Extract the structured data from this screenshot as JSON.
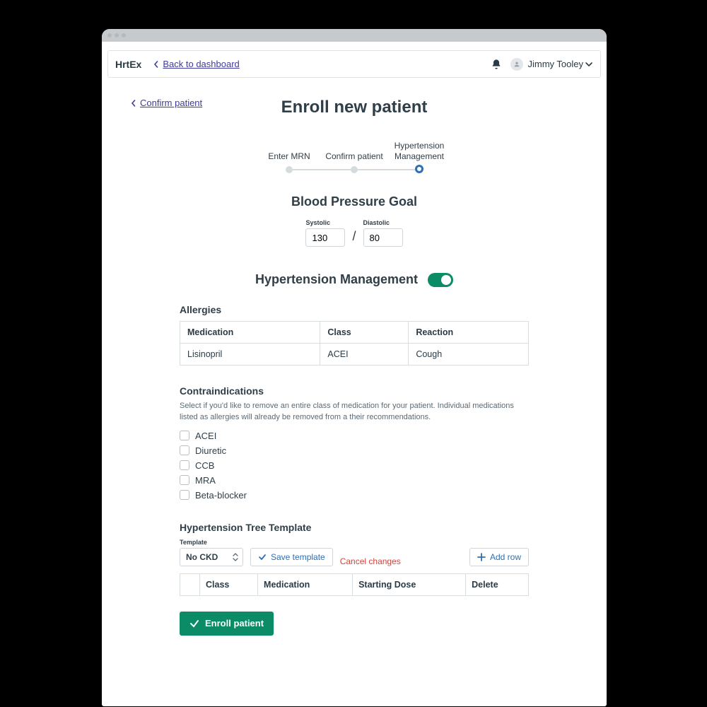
{
  "header": {
    "brand": "HrtEx",
    "back_label": "Back to dashboard",
    "user_name": "Jimmy Tooley"
  },
  "breadcrumb": {
    "back_label": "Confirm patient"
  },
  "page_title": "Enroll new patient",
  "stepper": {
    "steps": [
      {
        "label": "Enter MRN"
      },
      {
        "label": "Confirm patient"
      },
      {
        "label": "Hypertension Management"
      }
    ],
    "active_index": 2
  },
  "bp": {
    "heading": "Blood Pressure Goal",
    "systolic_label": "Systolic",
    "diastolic_label": "Diastolic",
    "systolic_value": "130",
    "diastolic_value": "80"
  },
  "htn": {
    "heading": "Hypertension Management",
    "enabled": true
  },
  "allergies": {
    "heading": "Allergies",
    "cols": {
      "medication": "Medication",
      "class": "Class",
      "reaction": "Reaction"
    },
    "rows": [
      {
        "medication": "Lisinopril",
        "class": "ACEI",
        "reaction": "Cough"
      }
    ]
  },
  "contra": {
    "heading": "Contraindications",
    "help": "Select if you'd like to remove an entire class of medication for your patient. Individual medications listed as allergies will already be removed from a their recommendations.",
    "options": [
      "ACEI",
      "Diuretic",
      "CCB",
      "MRA",
      "Beta-blocker"
    ]
  },
  "template": {
    "heading": "Hypertension Tree Template",
    "select_label": "Template",
    "select_value": "No CKD",
    "save_label": "Save template",
    "cancel_label": "Cancel changes",
    "add_row_label": "Add row",
    "cols": {
      "handle": "",
      "class": "Class",
      "medication": "Medication",
      "dose": "Starting Dose",
      "delete": "Delete"
    }
  },
  "actions": {
    "enroll_label": "Enroll patient"
  }
}
